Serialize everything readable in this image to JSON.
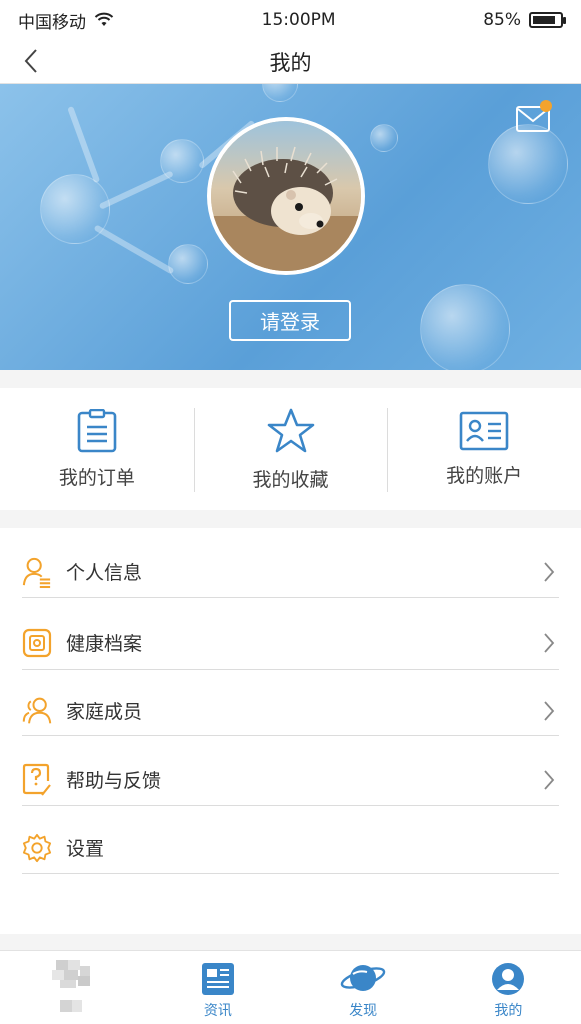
{
  "status": {
    "carrier": "中国移动",
    "time": "15:00PM",
    "battery": "85%",
    "battery_level": 0.85
  },
  "nav": {
    "title": "我的"
  },
  "profile": {
    "login_label": "请登录",
    "mail_unread": true
  },
  "quick_actions": [
    {
      "label": "我的订单",
      "icon": "clipboard-icon"
    },
    {
      "label": "我的收藏",
      "icon": "star-icon"
    },
    {
      "label": "我的账户",
      "icon": "id-card-icon"
    }
  ],
  "menu": [
    {
      "label": "个人信息",
      "icon": "person-icon",
      "chevron": true
    },
    {
      "label": "健康档案",
      "icon": "health-file-icon",
      "chevron": true
    },
    {
      "label": "家庭成员",
      "icon": "family-icon",
      "chevron": true
    },
    {
      "label": "帮助与反馈",
      "icon": "help-icon",
      "chevron": true
    },
    {
      "label": "设置",
      "icon": "gear-icon",
      "chevron": false
    }
  ],
  "tabs": [
    {
      "label": "",
      "icon": "home-icon"
    },
    {
      "label": "资讯",
      "icon": "news-icon"
    },
    {
      "label": "发现",
      "icon": "planet-icon"
    },
    {
      "label": "我的",
      "icon": "profile-icon"
    }
  ],
  "colors": {
    "accent_orange": "#f3a32c",
    "accent_blue": "#3a86c8",
    "hero_blue": "#5a9fd8"
  }
}
